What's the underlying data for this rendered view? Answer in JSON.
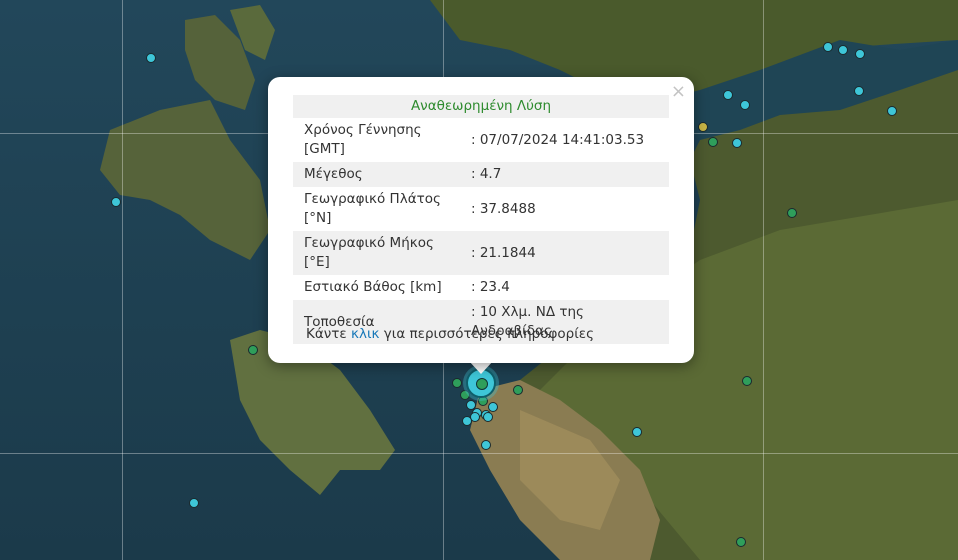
{
  "popup": {
    "header": "Αναθεωρημένη Λύση",
    "close_symbol": "×",
    "rows": [
      {
        "label": "Χρόνος Γέννησης [GMT]",
        "value": ": 07/07/2024 14:41:03.53"
      },
      {
        "label": "Μέγεθος",
        "value": ": 4.7"
      },
      {
        "label": "Γεωγραφικό Πλάτος [°N]",
        "value": ": 37.8488"
      },
      {
        "label": "Γεωγραφικό Μήκος [°E]",
        "value": ": 21.1844"
      },
      {
        "label": "Εστιακό Βάθος [km]",
        "value": ": 23.4"
      },
      {
        "label": "Τοποθεσία",
        "value": ": 10 Χλμ. ΝΔ της Ανδραβίδας"
      }
    ],
    "footer": {
      "prefix": "Κάντε",
      "link": "κλικ",
      "suffix": "για περισσότερες πληροφορίες"
    }
  },
  "colors": {
    "marker_cyan": "#3ec6d8",
    "marker_green": "#2f9e5b",
    "marker_yellow": "#c9b646",
    "header_text": "#2e8b2e",
    "link": "#1878b8"
  },
  "icons": {
    "close": "close-icon",
    "earthquake": "earthquake-marker"
  }
}
